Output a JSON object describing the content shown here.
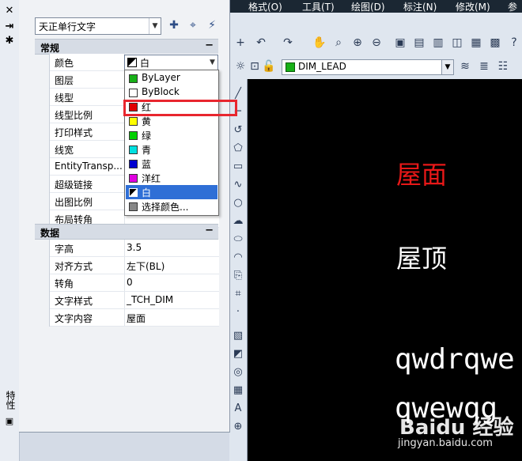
{
  "menubar": {
    "items": [
      "格式(O)",
      "工具(T)",
      "绘图(D)",
      "标注(N)",
      "修改(M)",
      "参"
    ]
  },
  "layer_toolbar": {
    "current_layer": "DIM_LEAD",
    "layer_color": "#18b018"
  },
  "dock": {
    "close_glyph": "✕",
    "vertical_title": "特性"
  },
  "palette": {
    "object_type": "天正单行文字",
    "sections": [
      {
        "title": "常规",
        "collapse": "−"
      },
      {
        "title": "数据",
        "collapse": "−"
      }
    ],
    "general_rows": [
      {
        "key": "颜色",
        "value": ""
      },
      {
        "key": "图层",
        "value": ""
      },
      {
        "key": "线型",
        "value": ""
      },
      {
        "key": "线型比例",
        "value": ""
      },
      {
        "key": "打印样式",
        "value": ""
      },
      {
        "key": "线宽",
        "value": ""
      },
      {
        "key": "EntityTransp...",
        "value": ""
      },
      {
        "key": "超级链接",
        "value": ""
      },
      {
        "key": "出图比例",
        "value": ""
      },
      {
        "key": "布局转角",
        "value": ""
      }
    ],
    "data_rows": [
      {
        "key": "字高",
        "value": "3.5"
      },
      {
        "key": "对齐方式",
        "value": "左下(BL)"
      },
      {
        "key": "转角",
        "value": "0"
      },
      {
        "key": "文字样式",
        "value": "_TCH_DIM"
      },
      {
        "key": "文字内容",
        "value": "屋面"
      }
    ]
  },
  "color_select": {
    "current": "白",
    "options": [
      {
        "label": "ByLayer",
        "color": "#18b018"
      },
      {
        "label": "ByBlock",
        "color": "#ffffff"
      },
      {
        "label": "红",
        "color": "#e00000"
      },
      {
        "label": "黄",
        "color": "#ffff00"
      },
      {
        "label": "绿",
        "color": "#00d000"
      },
      {
        "label": "青",
        "color": "#00e0e0"
      },
      {
        "label": "蓝",
        "color": "#0000d0"
      },
      {
        "label": "洋红",
        "color": "#e000e0"
      },
      {
        "label": "白",
        "color": "#ffffff"
      },
      {
        "label": "选择颜色...",
        "color": "#888888"
      }
    ],
    "selected_index": 8,
    "highlighted_index": 2,
    "highlight_color": "#e8262e"
  },
  "canvas": {
    "texts": [
      {
        "text": "屋面",
        "color": "#e81818"
      },
      {
        "text": "屋顶",
        "color": "#ffffff"
      },
      {
        "text": "qwdrqwe",
        "color": "#ffffff"
      },
      {
        "text": "qwewqg",
        "color": "#ffffff"
      }
    ]
  },
  "watermark": {
    "brand": "Baidu 经验",
    "url": "jingyan.baidu.com"
  }
}
